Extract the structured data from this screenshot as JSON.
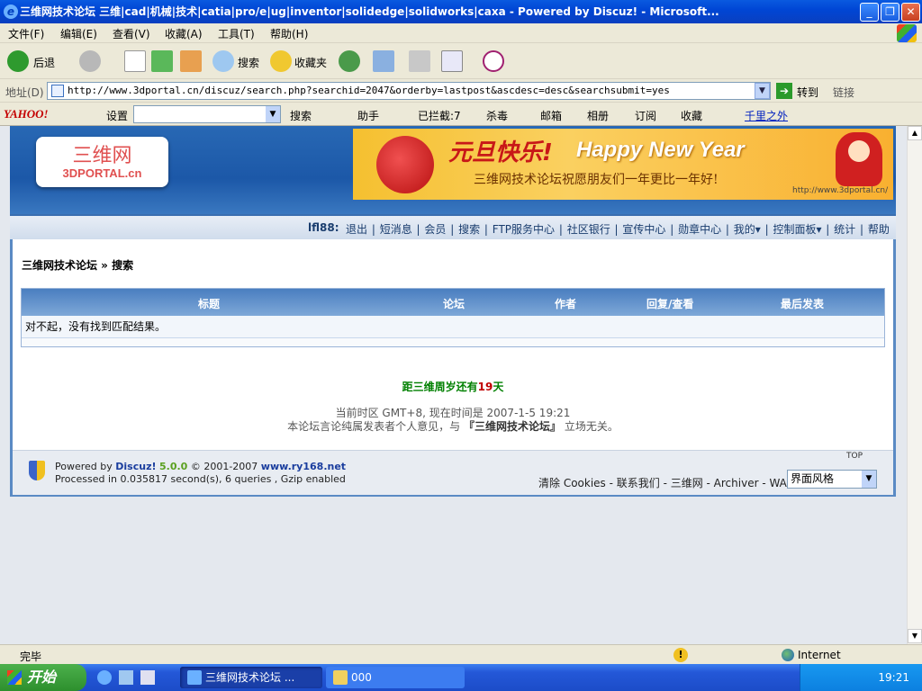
{
  "window": {
    "title": "三维网技术论坛 三维|cad|机械|技术|catia|pro/e|ug|inventor|solidedge|solidworks|caxa - Powered by Discuz! - Microsoft..."
  },
  "menu": [
    "文件(F)",
    "编辑(E)",
    "查看(V)",
    "收藏(A)",
    "工具(T)",
    "帮助(H)"
  ],
  "toolbar": {
    "back": "后退",
    "search": "搜索",
    "favorites": "收藏夹"
  },
  "address": {
    "label": "地址(D)",
    "url": "http://www.3dportal.cn/discuz/search.php?searchid=2047&orderby=lastpost&ascdesc=desc&searchsubmit=yes",
    "go": "转到",
    "links": "链接"
  },
  "yahoo_bar": {
    "logo": "YAHOO!",
    "settings": "设置",
    "search": "搜索",
    "helper": "助手",
    "blocked": "已拦截:7",
    "antivirus": "杀毒",
    "mail": "邮箱",
    "album": "相册",
    "subscribe": "订阅",
    "favorites": "收藏",
    "music": "千里之外"
  },
  "site": {
    "logo_cn": "三维网",
    "logo_en": "3DPORTAL.cn",
    "banner_title": "元旦快乐!",
    "banner_subtitle": "Happy New Year",
    "banner_wish": "三维网技术论坛祝愿朋友们一年更比一年好!",
    "banner_url": "http://www.3dportal.cn/"
  },
  "nav": {
    "user": "lfl88:",
    "items": [
      "退出",
      "短消息",
      "会员",
      "搜索",
      "FTP服务中心",
      "社区银行",
      "宣传中心",
      "勋章中心",
      "我的▾",
      "控制面板▾",
      "统计",
      "帮助"
    ]
  },
  "breadcrumb": "三维网技术论坛 » 搜索",
  "results": {
    "headers": [
      "标题",
      "论坛",
      "作者",
      "回复/查看",
      "最后发表"
    ],
    "empty_message": "对不起，没有找到匹配结果。"
  },
  "countdown": {
    "prefix": "距三维周岁还有",
    "days": "19",
    "suffix": "天"
  },
  "time_info": {
    "line1": "当前时区 GMT+8, 现在时间是 2007-1-5 19:21",
    "line2_prefix": "本论坛言论纯属发表者个人意见，与",
    "line2_name": "『三维网技术论坛』",
    "line2_suffix": "立场无关。"
  },
  "footer": {
    "top": "TOP",
    "powered_prefix": "Powered by",
    "discuz": "Discuz!",
    "version": "5.0.0",
    "copyright": "© 2001-2007",
    "site": "www.ry168.net",
    "processed": "Processed in 0.035817 second(s), 6 queries , Gzip enabled",
    "links": "清除 Cookies - 联系我们 - 三维网 - Archiver - WAP",
    "style_select": "界面风格"
  },
  "status": {
    "done": "完毕",
    "zone": "Internet"
  },
  "taskbar": {
    "start": "开始",
    "task1": "三维网技术论坛 ...",
    "task2": "000",
    "clock": "19:21"
  }
}
